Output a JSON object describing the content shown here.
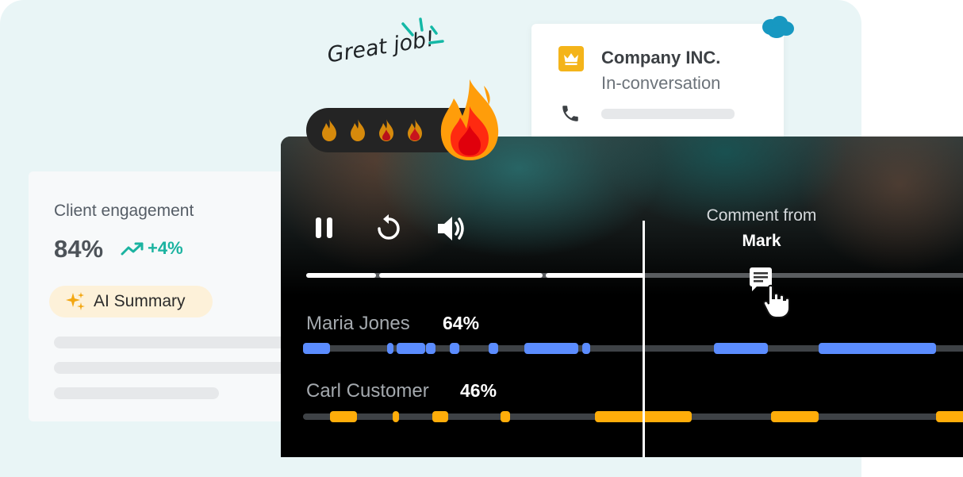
{
  "engagement": {
    "title": "Client engagement",
    "percent": "84%",
    "change": "+4%",
    "ai_summary_label": "AI Summary"
  },
  "company": {
    "name": "Company INC.",
    "status": "In-conversation"
  },
  "celebration": {
    "text": "Great job!"
  },
  "player": {
    "comment_from": "Comment from",
    "comment_author": "Mark",
    "speakers": [
      {
        "name": "Maria Jones",
        "percent": "64%",
        "color": "#5b8cff"
      },
      {
        "name": "Carl Customer",
        "percent": "46%",
        "color": "#ffad0a"
      }
    ],
    "icons": [
      "pause-icon",
      "replay-icon",
      "volume-icon",
      "comment-icon",
      "pointer-hand-icon"
    ]
  },
  "colors": {
    "accent_teal": "#1bb3a0",
    "crown_gold": "#f4b41a",
    "salesforce_blue": "#1798c1",
    "maria_blue": "#5b8cff",
    "carl_orange": "#ffad0a"
  }
}
